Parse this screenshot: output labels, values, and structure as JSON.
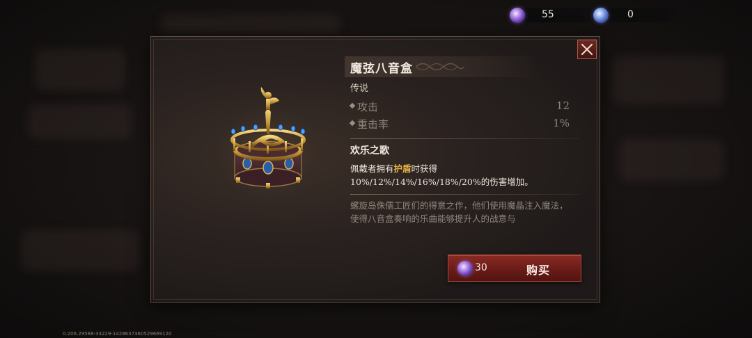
{
  "currency": [
    {
      "icon": "purple-crystal-icon",
      "amount": "55"
    },
    {
      "icon": "blue-crystal-icon",
      "amount": "0"
    }
  ],
  "item": {
    "name": "魔弦八音盒",
    "rarity": "传说",
    "stats": [
      {
        "label": "攻击",
        "value": "12"
      },
      {
        "label": "重击率",
        "value": "1%"
      }
    ],
    "effect": {
      "title": "欢乐之歌",
      "desc_before": "佩戴者拥有",
      "desc_highlight": "护盾",
      "desc_after": "时获得",
      "desc_line2": "10%/12%/14%/16%/18%/20%的伤害增加。"
    },
    "flavor": "螺旋岛侏儒工匠们的得意之作，他们使用魔晶注入魔法，使得八音盒奏响的乐曲能够提升人的战意与"
  },
  "buy": {
    "icon": "purple-crystal-icon",
    "price": "30",
    "label": "购买"
  },
  "close": {
    "icon": "close-icon"
  },
  "version_text": "0.206.29588-33229-1428637360529669120",
  "colors": {
    "highlight": "#e8b448",
    "buy_button": "#7a221d",
    "panel": "#2a2220"
  }
}
